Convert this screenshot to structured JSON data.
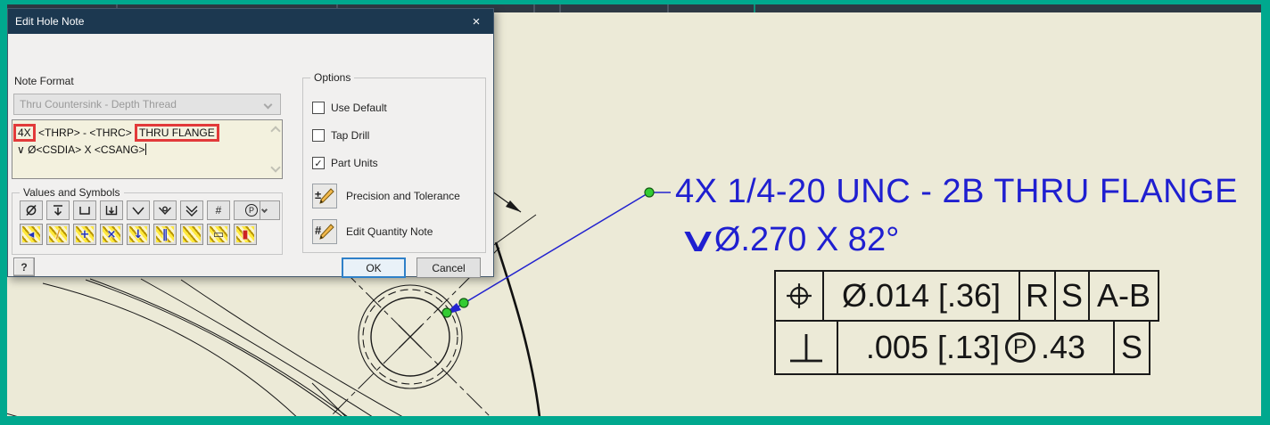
{
  "window": {
    "frame_color": "#00a88e",
    "canvas_bg": "#ecead7"
  },
  "dialog": {
    "title": "Edit Hole Note",
    "close_glyph": "×",
    "note_format_label": "Note Format",
    "note_format_value": "Thru Countersink - Depth Thread",
    "note_line1_boxed1": "4X",
    "note_line1_mid": " <THRP> - <THRC> ",
    "note_line1_boxed2": "THRU FLANGE",
    "note_line2_symbol": "∨",
    "note_line2_text": " Ø<CSDIA> X <CSANG>",
    "values_symbols_label": "Values and Symbols",
    "sym_row1": [
      {
        "name": "diameter-symbol"
      },
      {
        "name": "depth-symbol"
      },
      {
        "name": "counterbore-symbol"
      },
      {
        "name": "counterbore-depth-symbol"
      },
      {
        "name": "countersink-symbol"
      },
      {
        "name": "countersink-diameter-symbol"
      },
      {
        "name": "countersink-depth-symbol"
      },
      {
        "name": "number-symbol",
        "glyph": "#"
      },
      {
        "name": "quantity-note-symbol",
        "glyph": "P"
      }
    ],
    "sym_row2": [
      {
        "name": "thread-insert-left",
        "overlay": "◂",
        "color": "#2233bb"
      },
      {
        "name": "thread-edit",
        "overlay": "∕",
        "color": "#e09a20"
      },
      {
        "name": "thread-dimension",
        "overlay": "+",
        "color": "#2233bb"
      },
      {
        "name": "thread-delete",
        "overlay": "×",
        "color": "#2233bb"
      },
      {
        "name": "thread-depth",
        "overlay": "↓",
        "color": "#2233bb"
      },
      {
        "name": "thread-full",
        "overlay": "‖",
        "color": "#2233bb"
      },
      {
        "name": "thread-profile",
        "overlay": "",
        "color": "#b89400"
      },
      {
        "name": "thread-outline",
        "overlay": "▭",
        "color": "#333333"
      },
      {
        "name": "thread-section",
        "overlay": "▮",
        "color": "#cc2222"
      }
    ],
    "options_label": "Options",
    "checkboxes": [
      {
        "label": "Use Default",
        "mark": ""
      },
      {
        "label": "Tap Drill",
        "mark": ""
      },
      {
        "label": "Part Units",
        "mark": "✓"
      }
    ],
    "tool_buttons": [
      {
        "label": "Precision and Tolerance",
        "glyph": "±"
      },
      {
        "label": "Edit Quantity Note",
        "glyph": "#"
      }
    ],
    "help_glyph": "?",
    "ok_label": "OK",
    "cancel_label": "Cancel"
  },
  "drawing": {
    "hole_note_line1": "4X 1/4-20 UNC - 2B THRU FLANGE",
    "hole_note_line2_symbol": "∨",
    "hole_note_line2_text": "Ø.270 X 82°",
    "hole_note_color": "#1f1fd0",
    "fcf_row1": {
      "symbol": "position",
      "value": "Ø.014 [.36]",
      "d1": "R",
      "d2": "S",
      "d3": "A-B"
    },
    "fcf_row2": {
      "symbol": "perpendicularity",
      "value_pre": ".005 [.13]",
      "modifier": "P",
      "value_post": ".43",
      "d1": "S"
    }
  }
}
